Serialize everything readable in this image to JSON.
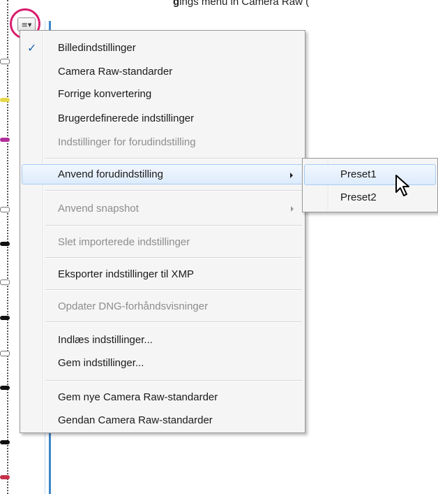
{
  "header": {
    "text_bold": "g",
    "text_rest": "ings menu in Camera Raw ("
  },
  "toolbar": {
    "menu_button_glyph": "≡▾",
    "menu_button_icon": "list-menu-icon",
    "highlight_color": "#d91c6d"
  },
  "menu": {
    "items": [
      {
        "label": "Billedindstillinger",
        "checked": true,
        "enabled": true
      },
      {
        "label": "Camera Raw-standarder",
        "enabled": true
      },
      {
        "label": "Forrige konvertering",
        "enabled": true
      },
      {
        "label": "Brugerdefinerede indstillinger",
        "enabled": true
      },
      {
        "label": "Indstillinger for forudindstilling",
        "enabled": false
      },
      {
        "label": "Anvend forudindstilling",
        "enabled": true,
        "submenu": true,
        "highlighted": true
      },
      {
        "label": "Anvend snapshot",
        "enabled": false,
        "submenu": true
      },
      {
        "label": "Slet importerede indstillinger",
        "enabled": false
      },
      {
        "label": "Eksporter indstillinger til XMP",
        "enabled": true
      },
      {
        "label": "Opdater DNG-forhåndsvisninger",
        "enabled": false
      },
      {
        "label": "Indlæs indstillinger...",
        "enabled": true
      },
      {
        "label": "Gem indstillinger...",
        "enabled": true
      },
      {
        "label": "Gem nye Camera Raw-standarder",
        "enabled": true
      },
      {
        "label": "Gendan Camera Raw-standarder",
        "enabled": true
      }
    ],
    "check_glyph": "✓"
  },
  "submenu": {
    "items": [
      {
        "label": "Preset1",
        "highlighted": true
      },
      {
        "label": "Preset2"
      }
    ]
  },
  "colors": {
    "accent_blue": "#3a86c8",
    "highlight_border": "#a8cbf1",
    "disabled_text": "#8d8d8d",
    "check": "#1f63b6"
  }
}
